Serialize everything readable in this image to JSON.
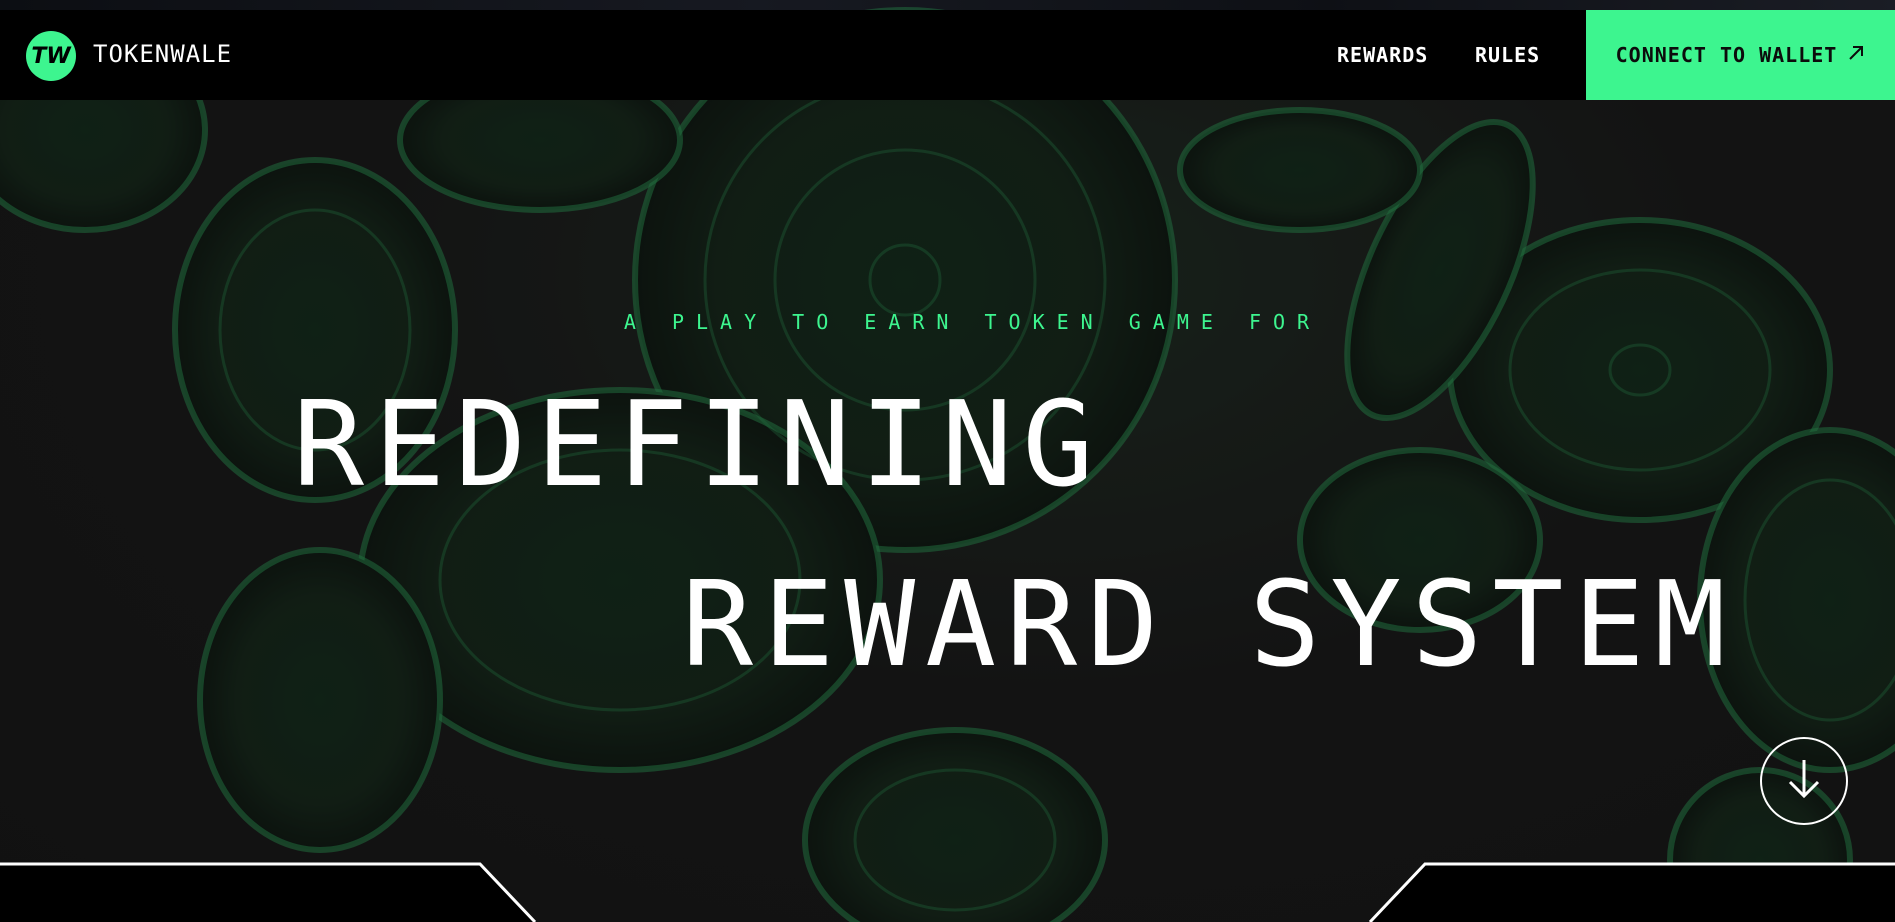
{
  "brand": {
    "logo_mark": "TW",
    "name": "TOKENWALE"
  },
  "nav": {
    "links": [
      {
        "label": "REWARDS"
      },
      {
        "label": "RULES"
      }
    ],
    "cta": {
      "label": "CONNECT TO WALLET",
      "icon": "arrow-up-right-icon"
    }
  },
  "hero": {
    "tagline": "A PLAY TO EARN TOKEN GAME FOR",
    "headline_line1": "REDEFINING",
    "headline_line2": "REWARD SYSTEM",
    "scroll_icon": "arrow-down-icon"
  },
  "colors": {
    "accent": "#3df58f",
    "background": "#141414",
    "navbar": "#000000",
    "text": "#ffffff"
  }
}
